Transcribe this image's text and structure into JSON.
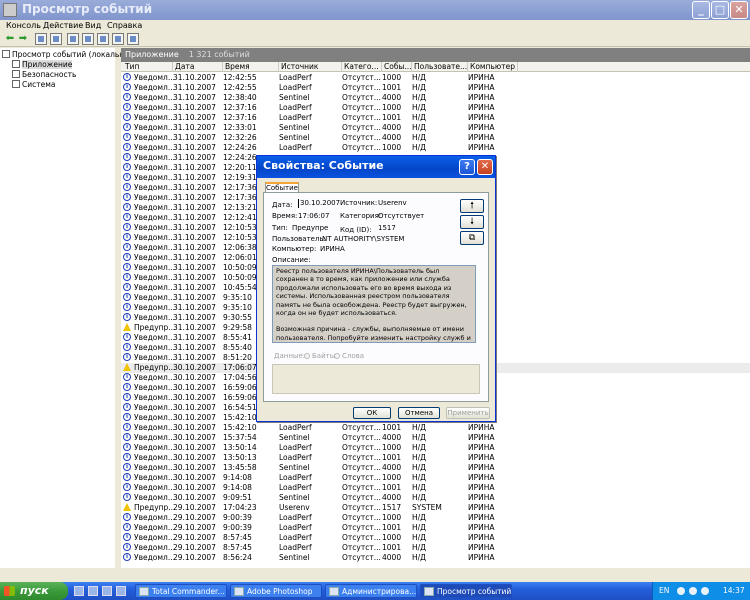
{
  "window": {
    "title": "Просмотр событий"
  },
  "menu": [
    "Консоль",
    "Действие",
    "Вид",
    "Справка"
  ],
  "tree": {
    "root": "Просмотр событий (локальн",
    "items": [
      "Приложение",
      "Безопасность",
      "Система"
    ]
  },
  "panel": {
    "title": "Приложение",
    "count": "1 321 событий"
  },
  "columns": [
    "Тип",
    "Дата",
    "Время",
    "Источник",
    "Катего...",
    "Собы...",
    "Пользовате...",
    "Компьютер"
  ],
  "rows": [
    [
      "info",
      "Уведомл...",
      "31.10.2007",
      "12:42:55",
      "LoadPerf",
      "Отсутст...",
      "1000",
      "Н/Д",
      "ИРИНА"
    ],
    [
      "info",
      "Уведомл...",
      "31.10.2007",
      "12:42:55",
      "LoadPerf",
      "Отсутст...",
      "1001",
      "Н/Д",
      "ИРИНА"
    ],
    [
      "info",
      "Уведомл...",
      "31.10.2007",
      "12:38:40",
      "Sentinel",
      "Отсутст...",
      "4000",
      "Н/Д",
      "ИРИНА"
    ],
    [
      "info",
      "Уведомл...",
      "31.10.2007",
      "12:37:16",
      "LoadPerf",
      "Отсутст...",
      "1000",
      "Н/Д",
      "ИРИНА"
    ],
    [
      "info",
      "Уведомл...",
      "31.10.2007",
      "12:37:16",
      "LoadPerf",
      "Отсутст...",
      "1001",
      "Н/Д",
      "ИРИНА"
    ],
    [
      "info",
      "Уведомл...",
      "31.10.2007",
      "12:33:01",
      "Sentinel",
      "Отсутст...",
      "4000",
      "Н/Д",
      "ИРИНА"
    ],
    [
      "info",
      "Уведомл...",
      "31.10.2007",
      "12:32:26",
      "Sentinel",
      "Отсутст...",
      "4000",
      "Н/Д",
      "ИРИНА"
    ],
    [
      "info",
      "Уведомл...",
      "31.10.2007",
      "12:24:26",
      "LoadPerf",
      "Отсутст...",
      "1000",
      "Н/Д",
      "ИРИНА"
    ],
    [
      "info",
      "Уведомл...",
      "31.10.2007",
      "12:24:26",
      "",
      "",
      "",
      "",
      ""
    ],
    [
      "info",
      "Уведомл...",
      "31.10.2007",
      "12:20:11",
      "",
      "",
      "",
      "",
      ""
    ],
    [
      "info",
      "Уведомл...",
      "31.10.2007",
      "12:19:31",
      "",
      "",
      "",
      "",
      ""
    ],
    [
      "info",
      "Уведомл...",
      "31.10.2007",
      "12:17:36",
      "",
      "",
      "",
      "",
      ""
    ],
    [
      "info",
      "Уведомл...",
      "31.10.2007",
      "12:17:36",
      "",
      "",
      "",
      "",
      ""
    ],
    [
      "info",
      "Уведомл...",
      "31.10.2007",
      "12:13:21",
      "",
      "",
      "",
      "",
      ""
    ],
    [
      "info",
      "Уведомл...",
      "31.10.2007",
      "12:12:41",
      "",
      "",
      "",
      "",
      ""
    ],
    [
      "info",
      "Уведомл...",
      "31.10.2007",
      "12:10:53",
      "",
      "",
      "",
      "",
      ""
    ],
    [
      "info",
      "Уведомл...",
      "31.10.2007",
      "12:10:53",
      "",
      "",
      "",
      "",
      ""
    ],
    [
      "info",
      "Уведомл...",
      "31.10.2007",
      "12:06:38",
      "",
      "",
      "",
      "",
      ""
    ],
    [
      "info",
      "Уведомл...",
      "31.10.2007",
      "12:06:01",
      "",
      "",
      "",
      "",
      ""
    ],
    [
      "info",
      "Уведомл...",
      "31.10.2007",
      "10:50:09",
      "",
      "",
      "",
      "",
      ""
    ],
    [
      "info",
      "Уведомл...",
      "31.10.2007",
      "10:50:09",
      "",
      "",
      "",
      "",
      ""
    ],
    [
      "info",
      "Уведомл...",
      "31.10.2007",
      "10:45:54",
      "",
      "",
      "",
      "",
      ""
    ],
    [
      "info",
      "Уведомл...",
      "31.10.2007",
      "9:35:10",
      "",
      "",
      "",
      "",
      ""
    ],
    [
      "info",
      "Уведомл...",
      "31.10.2007",
      "9:35:10",
      "",
      "",
      "",
      "",
      ""
    ],
    [
      "info",
      "Уведомл...",
      "31.10.2007",
      "9:30:55",
      "",
      "",
      "",
      "",
      ""
    ],
    [
      "warn",
      "Предупр...",
      "31.10.2007",
      "9:29:58",
      "",
      "",
      "",
      "",
      ""
    ],
    [
      "info",
      "Уведомл...",
      "31.10.2007",
      "8:55:41",
      "",
      "",
      "",
      "",
      ""
    ],
    [
      "info",
      "Уведомл...",
      "31.10.2007",
      "8:55:40",
      "",
      "",
      "",
      "",
      ""
    ],
    [
      "info",
      "Уведомл...",
      "31.10.2007",
      "8:51:20",
      "",
      "",
      "",
      "",
      ""
    ],
    [
      "warn",
      "Предупр...",
      "30.10.2007",
      "17:06:07",
      "",
      "",
      "",
      "",
      ""
    ],
    [
      "info",
      "Уведомл...",
      "30.10.2007",
      "17:04:56",
      "",
      "",
      "",
      "",
      ""
    ],
    [
      "info",
      "Уведомл...",
      "30.10.2007",
      "16:59:06",
      "",
      "",
      "",
      "",
      ""
    ],
    [
      "info",
      "Уведомл...",
      "30.10.2007",
      "16:59:06",
      "",
      "",
      "",
      "",
      ""
    ],
    [
      "info",
      "Уведомл...",
      "30.10.2007",
      "16:54:51",
      "",
      "",
      "",
      "",
      ""
    ],
    [
      "info",
      "Уведомл...",
      "30.10.2007",
      "15:42:10",
      "",
      "",
      "",
      "",
      ""
    ],
    [
      "info",
      "Уведомл...",
      "30.10.2007",
      "15:42:10",
      "LoadPerf",
      "Отсутст...",
      "1001",
      "Н/Д",
      "ИРИНА"
    ],
    [
      "info",
      "Уведомл...",
      "30.10.2007",
      "15:37:54",
      "Sentinel",
      "Отсутст...",
      "4000",
      "Н/Д",
      "ИРИНА"
    ],
    [
      "info",
      "Уведомл...",
      "30.10.2007",
      "13:50:14",
      "LoadPerf",
      "Отсутст...",
      "1000",
      "Н/Д",
      "ИРИНА"
    ],
    [
      "info",
      "Уведомл...",
      "30.10.2007",
      "13:50:13",
      "LoadPerf",
      "Отсутст...",
      "1001",
      "Н/Д",
      "ИРИНА"
    ],
    [
      "info",
      "Уведомл...",
      "30.10.2007",
      "13:45:58",
      "Sentinel",
      "Отсутст...",
      "4000",
      "Н/Д",
      "ИРИНА"
    ],
    [
      "info",
      "Уведомл...",
      "30.10.2007",
      "9:14:08",
      "LoadPerf",
      "Отсутст...",
      "1000",
      "Н/Д",
      "ИРИНА"
    ],
    [
      "info",
      "Уведомл...",
      "30.10.2007",
      "9:14:08",
      "LoadPerf",
      "Отсутст...",
      "1001",
      "Н/Д",
      "ИРИНА"
    ],
    [
      "info",
      "Уведомл...",
      "30.10.2007",
      "9:09:51",
      "Sentinel",
      "Отсутст...",
      "4000",
      "Н/Д",
      "ИРИНА"
    ],
    [
      "warn",
      "Предупр...",
      "29.10.2007",
      "17:04:23",
      "Userenv",
      "Отсутст...",
      "1517",
      "SYSTEM",
      "ИРИНА"
    ],
    [
      "info",
      "Уведомл...",
      "29.10.2007",
      "9:00:39",
      "LoadPerf",
      "Отсутст...",
      "1000",
      "Н/Д",
      "ИРИНА"
    ],
    [
      "info",
      "Уведомл...",
      "29.10.2007",
      "9:00:39",
      "LoadPerf",
      "Отсутст...",
      "1001",
      "Н/Д",
      "ИРИНА"
    ],
    [
      "info",
      "Уведомл...",
      "29.10.2007",
      "8:57:45",
      "LoadPerf",
      "Отсутст...",
      "1000",
      "Н/Д",
      "ИРИНА"
    ],
    [
      "info",
      "Уведомл...",
      "29.10.2007",
      "8:57:45",
      "LoadPerf",
      "Отсутст...",
      "1001",
      "Н/Д",
      "ИРИНА"
    ],
    [
      "info",
      "Уведомл...",
      "29.10.2007",
      "8:56:24",
      "Sentinel",
      "Отсутст...",
      "4000",
      "Н/Д",
      "ИРИНА"
    ]
  ],
  "selected_row": 29,
  "dialog": {
    "title": "Свойства: Событие",
    "tab": "Событие",
    "date_label": "Дата:",
    "date": "30.10.2007",
    "source_label": "Источник:",
    "source": "Userenv",
    "time_label": "Время:",
    "time": "17:06:07",
    "category_label": "Категория:",
    "category": "Отсутствует",
    "type_label": "Тип:",
    "type": "Предупре",
    "code_label": "Код (ID):",
    "code": "1517",
    "user_label": "Пользователь:",
    "user": "NT AUTHORITY\\SYSTEM",
    "computer_label": "Компьютер:",
    "computer": "ИРИНА",
    "description_label": "Описание:",
    "description_p1": "Реестр пользователя ИРИНА\\Пользователь был сохранен в то время, как приложение или служба продолжали использовать его во время выхода из системы. Использованная реестром пользователя память не была освобождена. Реестр будет выгружен, когда он не будет использоваться.",
    "description_p2": "Возможная причина - службы, выполняемые от имени пользователя. Попробуйте изменить настройку служб и задать их выполнение с учетными записями LocalService или NetworkService.",
    "data_label": "Данные:",
    "bytes_label": "Байты",
    "words_label": "Слова",
    "ok": "ОК",
    "cancel": "Отмена",
    "apply": "Применить",
    "help": "?",
    "close": "✕"
  },
  "taskbar": {
    "start": "пуск",
    "tasks": [
      "Total Commander...",
      "Adobe Photoshop",
      "Администрирова...",
      "Просмотр событий"
    ],
    "lang": "EN",
    "clock": "14:37"
  },
  "colors": {
    "title_inactive": "#8fa3d6",
    "dialog_title": "#0a52e0",
    "taskbar": "#245edb",
    "start": "#3b9a3a"
  }
}
